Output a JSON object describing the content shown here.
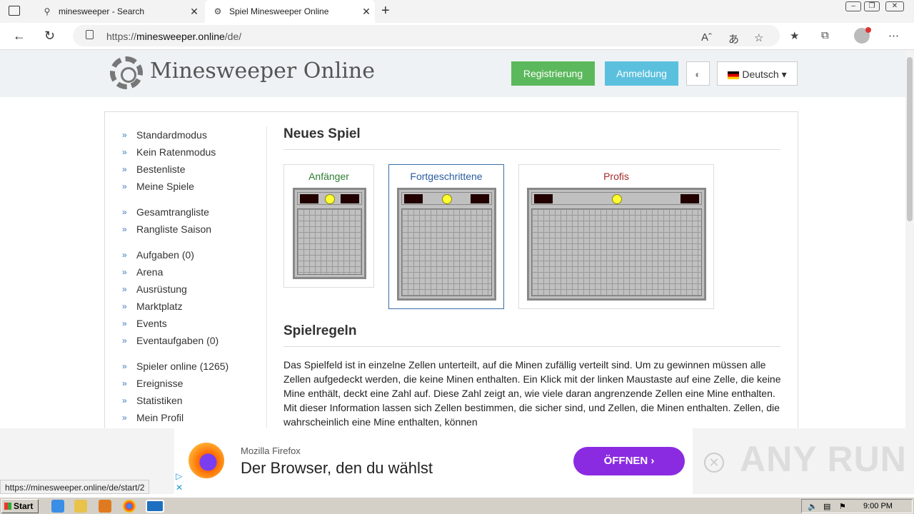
{
  "browser": {
    "tabs": [
      {
        "title": "minesweeper - Search",
        "icon": "search-icon"
      },
      {
        "title": "Spiel Minesweeper Online",
        "icon": "gear-icon"
      }
    ],
    "url_prefix": "https://",
    "url_host": "minesweeper.online",
    "url_path": "/de/"
  },
  "header": {
    "site_title": "Minesweeper Online",
    "register_label": "Registrierung",
    "login_label": "Anmeldung",
    "language_label": "Deutsch"
  },
  "sidebar": {
    "groups": [
      [
        "Standardmodus",
        "Kein Ratenmodus",
        "Bestenliste",
        "Meine Spiele"
      ],
      [
        "Gesamtrangliste",
        "Rangliste Saison"
      ],
      [
        "Aufgaben (0)",
        "Arena",
        "Ausrüstung",
        "Marktplatz",
        "Events",
        "Eventaufgaben (0)"
      ],
      [
        "Spieler online (1265)",
        "Ereignisse",
        "Statistiken",
        "Mein Profil"
      ]
    ]
  },
  "new_game": {
    "title": "Neues Spiel",
    "levels": [
      {
        "label": "Anfänger",
        "color": "#2e7d32"
      },
      {
        "label": "Fortgeschrittene",
        "color": "#2a5d9f"
      },
      {
        "label": "Profis",
        "color": "#a52a2a"
      }
    ]
  },
  "rules": {
    "title": "Spielregeln",
    "text": "Das Spielfeld ist in einzelne Zellen unterteilt, auf die Minen zufällig verteilt sind. Um zu gewinnen müssen alle Zellen aufgedeckt werden, die keine Minen enthalten. Ein Klick mit der linken Maustaste auf eine Zelle, die keine Mine enthält, deckt eine Zahl auf. Diese Zahl zeigt an, wie viele daran angrenzende Zellen eine Mine enthalten. Mit dieser Information lassen sich Zellen bestimmen, die sicher sind, und Zellen, die Minen enthalten. Zellen, die wahrscheinlich eine Mine enthalten, können"
  },
  "ad": {
    "brand": "Mozilla Firefox",
    "headline": "Der Browser, den du wählst",
    "button_label": "ÖFFNEN",
    "watermark": "ANY RUN"
  },
  "status_url": "https://minesweeper.online/de/start/2",
  "taskbar": {
    "start_label": "Start",
    "clock": "9:00 PM"
  }
}
